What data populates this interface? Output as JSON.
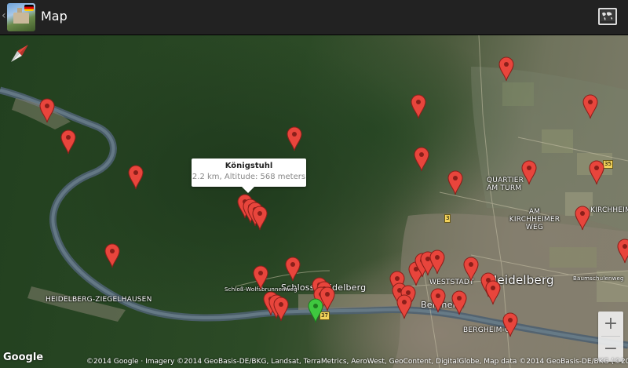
{
  "actionbar": {
    "up_caret": "‹",
    "title": "Map",
    "app_icon": "heidelberg-castle-app-icon",
    "layers_icon": "world-map-icon"
  },
  "map": {
    "callout": {
      "title": "Königstuhl",
      "subtitle": "2.2 km, Altitude: 568 meters"
    },
    "labels": {
      "ziegelhausen": "HEIDELBERG-ZIEGELHAUSEN",
      "schlosslabel": "Schloss Heidelberg",
      "heidelberg": "Heidelberg",
      "weststadt": "WESTSTADT",
      "bergheim_center": "Bergheim",
      "bergheim": "BERGHEIM-C",
      "quartier": "QUARTIER AM TURM",
      "kirchheimer": "AM KIRCHHEIMER WEG",
      "kirchheim": "KIRCHHEIM",
      "baumschulenweg": "Baumschulenweg",
      "schlosswolfsbrunnenweg": "Schloß-Wolfsbrunnenweg"
    },
    "road_badges": [
      "3",
      "37",
      "35"
    ],
    "zoom_in": "+",
    "zoom_out": "−",
    "google": "Google",
    "attribution": "©2014 Google · Imagery ©2014 GeoBasis-DE/BKG, Landsat, TerraMetrics, AeroWest, GeoContent, DigitalGlobe, Map data ©2014 GeoBasis-DE/BKG (©2009), Google"
  },
  "colors": {
    "actionbar": "#222222",
    "pin_red": "#e8453c",
    "pin_green": "#3fc83f"
  }
}
